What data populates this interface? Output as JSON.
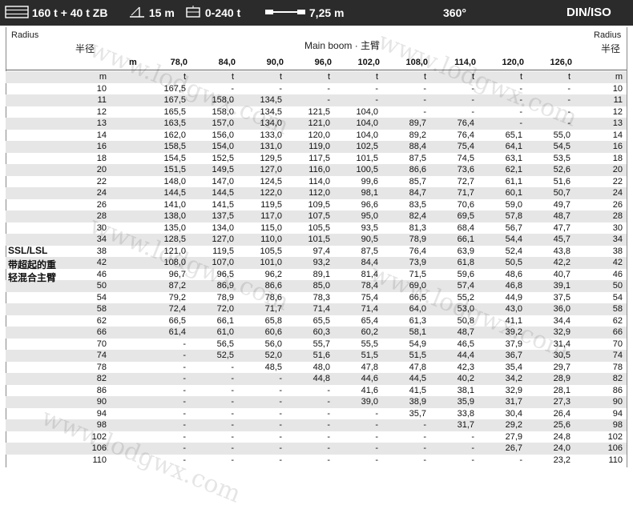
{
  "topbar": {
    "counterweight": "160 t + 40 t ZB",
    "superlift_radius": "15 m",
    "superlift_weight": "0-240 t",
    "width": "7,25 m",
    "rotation": "360°",
    "standard": "DIN/ISO"
  },
  "table": {
    "radius_en": "Radius",
    "radius_zh": "半径",
    "boom_title": "Main boom · 主臂",
    "unit_m": "m",
    "unit_t": "t",
    "side_label_1": "SSL/LSL",
    "side_label_2": "带超起的重",
    "side_label_3": "轻混合主臂",
    "boom_lengths": [
      "78,0",
      "84,0",
      "90,0",
      "96,0",
      "102,0",
      "108,0",
      "114,0",
      "120,0",
      "126,0"
    ],
    "rows": [
      {
        "r": "10",
        "v": [
          "167,5",
          "-",
          "-",
          "-",
          "-",
          "-",
          "-",
          "-",
          "-"
        ]
      },
      {
        "r": "11",
        "v": [
          "167,5",
          "158,0",
          "134,5",
          "-",
          "-",
          "-",
          "-",
          "-",
          "-"
        ]
      },
      {
        "r": "12",
        "v": [
          "165,5",
          "158,0",
          "134,5",
          "121,5",
          "104,0",
          "-",
          "-",
          "-",
          "-"
        ]
      },
      {
        "r": "13",
        "v": [
          "163,5",
          "157,0",
          "134,0",
          "121,0",
          "104,0",
          "89,7",
          "76,4",
          "-",
          "-"
        ]
      },
      {
        "r": "14",
        "v": [
          "162,0",
          "156,0",
          "133,0",
          "120,0",
          "104,0",
          "89,2",
          "76,4",
          "65,1",
          "55,0"
        ]
      },
      {
        "r": "16",
        "v": [
          "158,5",
          "154,0",
          "131,0",
          "119,0",
          "102,5",
          "88,4",
          "75,4",
          "64,1",
          "54,5"
        ]
      },
      {
        "r": "18",
        "v": [
          "154,5",
          "152,5",
          "129,5",
          "117,5",
          "101,5",
          "87,5",
          "74,5",
          "63,1",
          "53,5"
        ]
      },
      {
        "r": "20",
        "v": [
          "151,5",
          "149,5",
          "127,0",
          "116,0",
          "100,5",
          "86,6",
          "73,6",
          "62,1",
          "52,6"
        ]
      },
      {
        "r": "22",
        "v": [
          "148,0",
          "147,0",
          "124,5",
          "114,0",
          "99,6",
          "85,7",
          "72,7",
          "61,1",
          "51,6"
        ]
      },
      {
        "r": "24",
        "v": [
          "144,5",
          "144,5",
          "122,0",
          "112,0",
          "98,1",
          "84,7",
          "71,7",
          "60,1",
          "50,7"
        ]
      },
      {
        "r": "26",
        "v": [
          "141,0",
          "141,5",
          "119,5",
          "109,5",
          "96,6",
          "83,5",
          "70,6",
          "59,0",
          "49,7"
        ]
      },
      {
        "r": "28",
        "v": [
          "138,0",
          "137,5",
          "117,0",
          "107,5",
          "95,0",
          "82,4",
          "69,5",
          "57,8",
          "48,7"
        ]
      },
      {
        "r": "30",
        "v": [
          "135,0",
          "134,0",
          "115,0",
          "105,5",
          "93,5",
          "81,3",
          "68,4",
          "56,7",
          "47,7"
        ]
      },
      {
        "r": "34",
        "v": [
          "128,5",
          "127,0",
          "110,0",
          "101,5",
          "90,5",
          "78,9",
          "66,1",
          "54,4",
          "45,7"
        ]
      },
      {
        "r": "38",
        "v": [
          "121,0",
          "119,5",
          "105,5",
          "97,4",
          "87,5",
          "76,4",
          "63,9",
          "52,4",
          "43,8"
        ]
      },
      {
        "r": "42",
        "v": [
          "108,0",
          "107,0",
          "101,0",
          "93,2",
          "84,4",
          "73,9",
          "61,8",
          "50,5",
          "42,2"
        ]
      },
      {
        "r": "46",
        "v": [
          "96,7",
          "96,5",
          "96,2",
          "89,1",
          "81,4",
          "71,5",
          "59,6",
          "48,6",
          "40,7"
        ]
      },
      {
        "r": "50",
        "v": [
          "87,2",
          "86,9",
          "86,6",
          "85,0",
          "78,4",
          "69,0",
          "57,4",
          "46,8",
          "39,1"
        ]
      },
      {
        "r": "54",
        "v": [
          "79,2",
          "78,9",
          "78,6",
          "78,3",
          "75,4",
          "66,5",
          "55,2",
          "44,9",
          "37,5"
        ]
      },
      {
        "r": "58",
        "v": [
          "72,4",
          "72,0",
          "71,7",
          "71,4",
          "71,4",
          "64,0",
          "53,0",
          "43,0",
          "36,0"
        ]
      },
      {
        "r": "62",
        "v": [
          "66,5",
          "66,1",
          "65,8",
          "65,5",
          "65,4",
          "61,3",
          "50,8",
          "41,1",
          "34,4"
        ]
      },
      {
        "r": "66",
        "v": [
          "61,4",
          "61,0",
          "60,6",
          "60,3",
          "60,2",
          "58,1",
          "48,7",
          "39,2",
          "32,9"
        ]
      },
      {
        "r": "70",
        "v": [
          "-",
          "56,5",
          "56,0",
          "55,7",
          "55,5",
          "54,9",
          "46,5",
          "37,9",
          "31,4"
        ]
      },
      {
        "r": "74",
        "v": [
          "-",
          "52,5",
          "52,0",
          "51,6",
          "51,5",
          "51,5",
          "44,4",
          "36,7",
          "30,5"
        ]
      },
      {
        "r": "78",
        "v": [
          "-",
          "-",
          "48,5",
          "48,0",
          "47,8",
          "47,8",
          "42,3",
          "35,4",
          "29,7"
        ]
      },
      {
        "r": "82",
        "v": [
          "-",
          "-",
          "-",
          "44,8",
          "44,6",
          "44,5",
          "40,2",
          "34,2",
          "28,9"
        ]
      },
      {
        "r": "86",
        "v": [
          "-",
          "-",
          "-",
          "-",
          "41,6",
          "41,5",
          "38,1",
          "32,9",
          "28,1"
        ]
      },
      {
        "r": "90",
        "v": [
          "-",
          "-",
          "-",
          "-",
          "39,0",
          "38,9",
          "35,9",
          "31,7",
          "27,3"
        ]
      },
      {
        "r": "94",
        "v": [
          "-",
          "-",
          "-",
          "-",
          "-",
          "35,7",
          "33,8",
          "30,4",
          "26,4"
        ]
      },
      {
        "r": "98",
        "v": [
          "-",
          "-",
          "-",
          "-",
          "-",
          "-",
          "31,7",
          "29,2",
          "25,6"
        ]
      },
      {
        "r": "102",
        "v": [
          "-",
          "-",
          "-",
          "-",
          "-",
          "-",
          "-",
          "27,9",
          "24,8"
        ]
      },
      {
        "r": "106",
        "v": [
          "-",
          "-",
          "-",
          "-",
          "-",
          "-",
          "-",
          "26,7",
          "24,0"
        ]
      },
      {
        "r": "110",
        "v": [
          "-",
          "-",
          "-",
          "-",
          "-",
          "-",
          "-",
          "-",
          "23,2"
        ]
      }
    ]
  },
  "watermark": "www.lodgwx.com"
}
